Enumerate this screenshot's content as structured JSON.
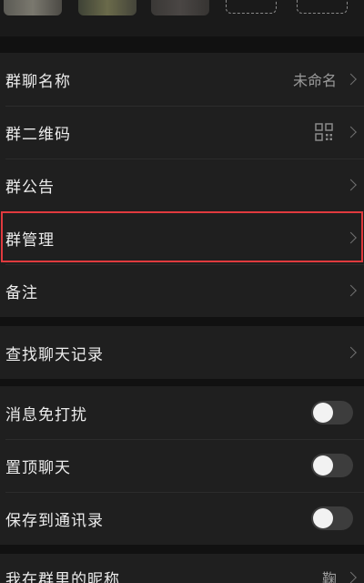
{
  "settings": {
    "group_name": {
      "label": "群聊名称",
      "value": "未命名"
    },
    "group_qr": {
      "label": "群二维码"
    },
    "group_notice": {
      "label": "群公告"
    },
    "group_manage": {
      "label": "群管理"
    },
    "remark": {
      "label": "备注"
    },
    "search_history": {
      "label": "查找聊天记录"
    },
    "mute": {
      "label": "消息免打扰",
      "on": false
    },
    "sticky": {
      "label": "置顶聊天",
      "on": false
    },
    "save_contacts": {
      "label": "保存到通讯录",
      "on": false
    },
    "my_nickname": {
      "label": "我在群里的昵称",
      "value": "鞠"
    }
  },
  "colors": {
    "highlight": "#e03a3e",
    "background": "#111111",
    "row_bg": "#1f1f1f"
  }
}
